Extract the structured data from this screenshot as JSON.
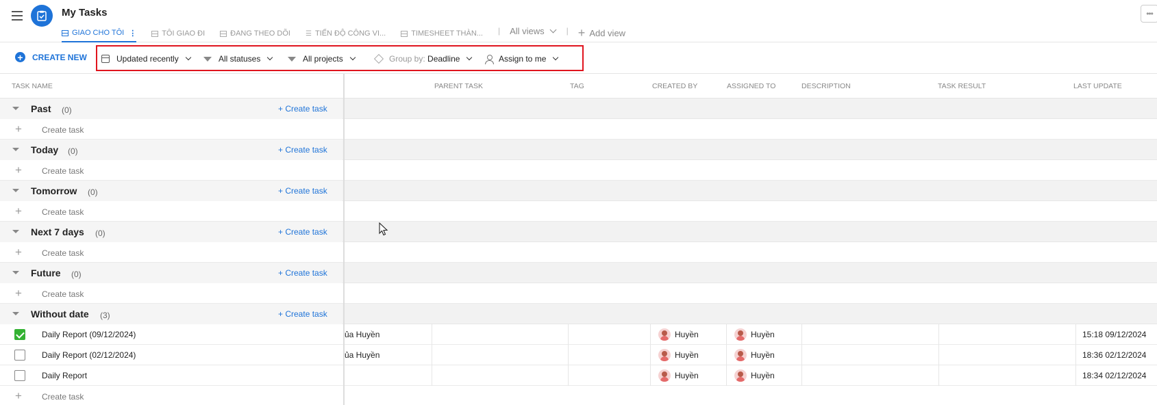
{
  "header": {
    "title": "My Tasks",
    "more_label": "•••",
    "tabs": [
      {
        "label": "GIAO CHO TÔI",
        "active": true
      },
      {
        "label": "TÔI GIAO ĐI",
        "active": false
      },
      {
        "label": "ĐANG THEO DÕI",
        "active": false
      },
      {
        "label": "TIẾN ĐỘ CÔNG VI...",
        "active": false
      },
      {
        "label": "TIMESHEET THÀN...",
        "active": false
      }
    ],
    "all_views": "All views",
    "add_view": "Add view"
  },
  "toolbar": {
    "create_new": "CREATE NEW",
    "sort": "Updated recently",
    "status_filter": "All statuses",
    "project_filter": "All projects",
    "group_by_label": "Group by:",
    "group_by_value": "Deadline",
    "assign_filter": "Assign to me"
  },
  "columns": [
    "TASK NAME",
    "PARENT TASK",
    "TAG",
    "CREATED BY",
    "ASSIGNED TO",
    "DESCRIPTION",
    "TASK RESULT",
    "LAST UPDATE"
  ],
  "create_task_label": "Create task",
  "groups": [
    {
      "title": "Past",
      "count": "(0)"
    },
    {
      "title": "Today",
      "count": "(0)"
    },
    {
      "title": "Tomorrow",
      "count": "(0)"
    },
    {
      "title": "Next 7 days",
      "count": "(0)"
    },
    {
      "title": "Future",
      "count": "(0)"
    },
    {
      "title": "Without date",
      "count": "(3)"
    }
  ],
  "tasks": [
    {
      "name": "Daily Report (09/12/2024)",
      "done": true,
      "truncated": "ủa Huyền",
      "created_by": "Huyền",
      "assigned_to": "Huyền",
      "last_update": "15:18 09/12/2024"
    },
    {
      "name": "Daily Report (02/12/2024)",
      "done": false,
      "truncated": "ủa Huyền",
      "created_by": "Huyền",
      "assigned_to": "Huyền",
      "last_update": "18:36 02/12/2024"
    },
    {
      "name": "Daily Report",
      "done": false,
      "truncated": "",
      "created_by": "Huyền",
      "assigned_to": "Huyền",
      "last_update": "18:34 02/12/2024"
    }
  ],
  "colors": {
    "accent": "#1e73d8",
    "highlight": "#e0141e",
    "done": "#34b233"
  }
}
